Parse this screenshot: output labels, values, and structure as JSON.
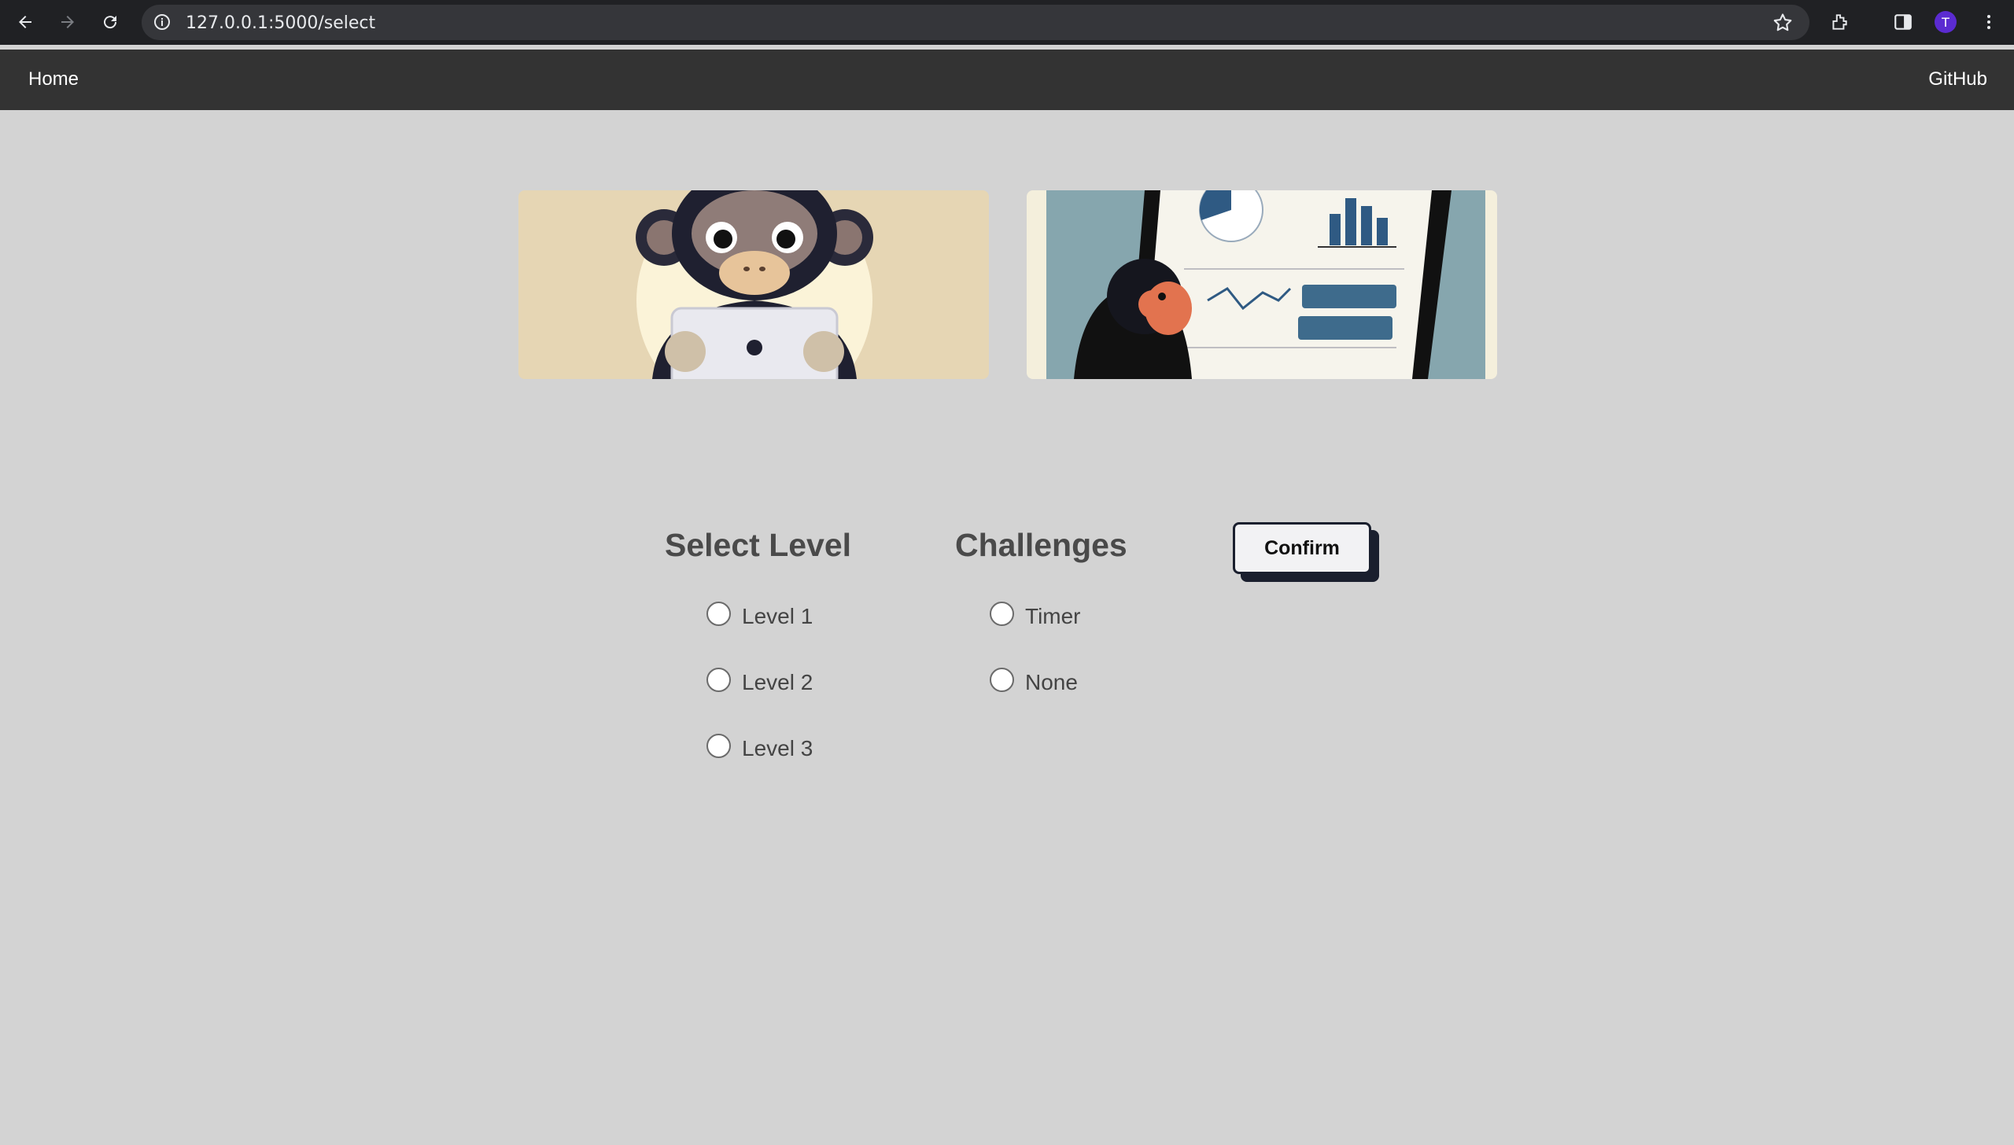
{
  "browser": {
    "url": "127.0.0.1:5000/select",
    "profile_initial": "T"
  },
  "nav": {
    "home": "Home",
    "github": "GitHub"
  },
  "images": [
    {
      "name": "chimp-with-tablet-image"
    },
    {
      "name": "chimp-looking-at-dashboard-image"
    }
  ],
  "level": {
    "title": "Select Level",
    "options": [
      "Level 1",
      "Level 2",
      "Level 3"
    ]
  },
  "challenges": {
    "title": "Challenges",
    "options": [
      "Timer",
      "None"
    ]
  },
  "confirm_label": "Confirm",
  "colors": {
    "page_bg": "#d3d3d3",
    "nav_bg": "#333333",
    "heading": "#4a4a4a",
    "button_border": "#1a1f2e"
  }
}
